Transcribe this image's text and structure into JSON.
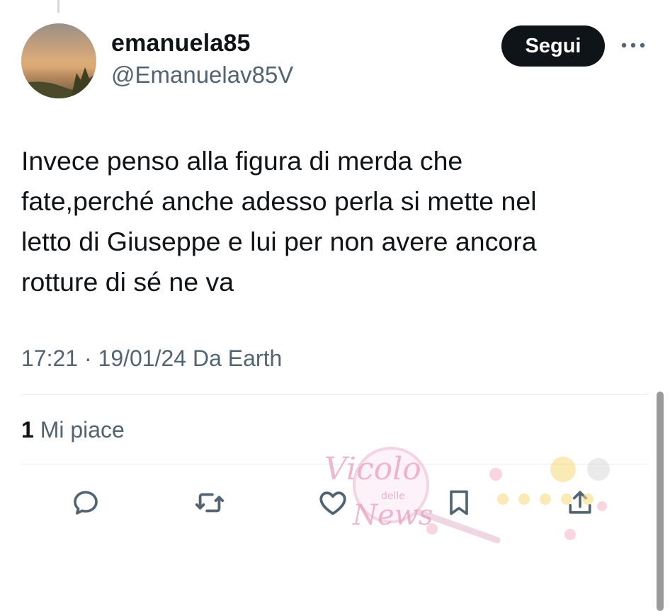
{
  "user": {
    "display_name": "emanuela85",
    "handle": "@Emanuelav85V"
  },
  "follow_label": "Segui",
  "more_icon": "more-horizontal-icon",
  "tweet": {
    "lines": [
      "Invece penso alla figura di merda che",
      "fate,perché anche adesso perla si mette nel",
      "letto di Giuseppe e lui per non avere ancora",
      "rotture di sé ne va"
    ],
    "time": "17:21",
    "separator": "·",
    "date": "19/01/24",
    "source": "Da Earth"
  },
  "likes": {
    "count": "1",
    "label": "Mi piace"
  },
  "actions": [
    {
      "icon": "reply-icon"
    },
    {
      "icon": "retweet-icon"
    },
    {
      "icon": "like-icon"
    },
    {
      "icon": "bookmark-icon"
    },
    {
      "icon": "share-icon"
    }
  ],
  "watermark": {
    "text_main": "Vicolo",
    "text_small": "delle",
    "text_bottom": "News"
  },
  "colors": {
    "text_primary": "#0f1419",
    "text_secondary": "#536471",
    "follow_bg": "#0f1419",
    "divider": "#e6ecf0",
    "watermark_pink": "#e8a0c0"
  }
}
